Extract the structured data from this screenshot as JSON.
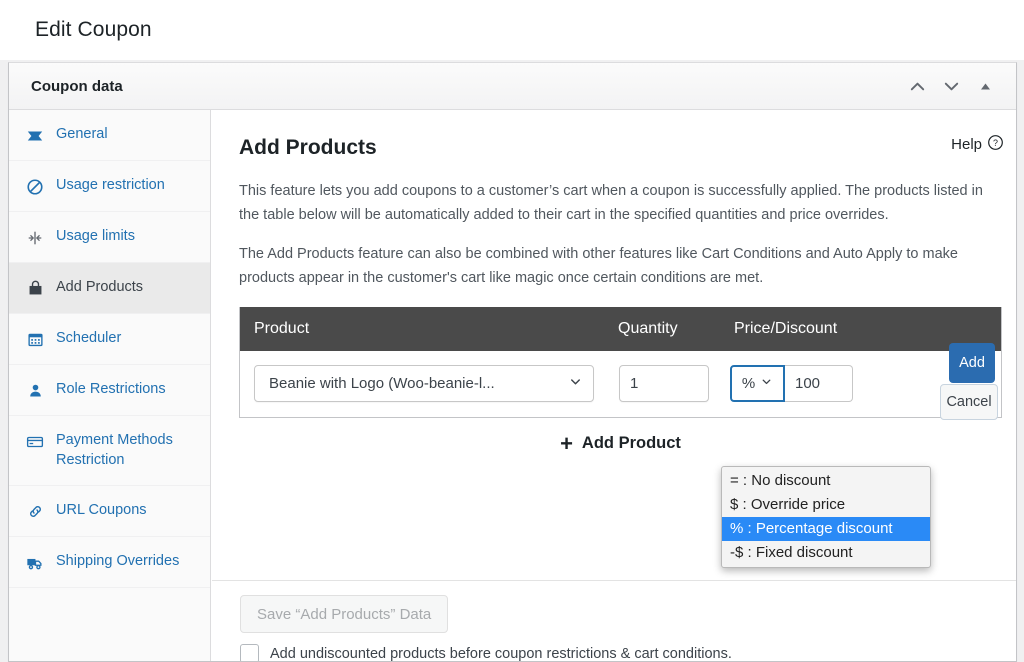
{
  "page": {
    "title": "Edit Coupon"
  },
  "panel": {
    "title": "Coupon data",
    "controls": [
      {
        "name": "move-up-icon",
        "label": "Move up"
      },
      {
        "name": "move-down-icon",
        "label": "Move down"
      },
      {
        "name": "toggle-panel-icon",
        "label": "Toggle panel"
      }
    ]
  },
  "sidebar": {
    "items": [
      {
        "label": "General",
        "icon": "ticket-icon",
        "active": false
      },
      {
        "label": "Usage restriction",
        "icon": "prohibited-icon",
        "active": false
      },
      {
        "label": "Usage limits",
        "icon": "limits-icon",
        "active": false
      },
      {
        "label": "Add Products",
        "icon": "shopping-bag-icon",
        "active": true
      },
      {
        "label": "Scheduler",
        "icon": "calendar-icon",
        "active": false
      },
      {
        "label": "Role Restrictions",
        "icon": "user-icon",
        "active": false
      },
      {
        "label": "Payment Methods Restriction",
        "icon": "credit-card-icon",
        "active": false
      },
      {
        "label": "URL Coupons",
        "icon": "link-icon",
        "active": false
      },
      {
        "label": "Shipping Overrides",
        "icon": "truck-icon",
        "active": false
      }
    ]
  },
  "main": {
    "help_label": "Help",
    "section_title": "Add Products",
    "paragraph_1": "This feature lets you add coupons to a customer’s cart when a coupon is successfully applied. The products listed in the table below will be automatically added to their cart in the specified quantities and price overrides.",
    "paragraph_2": "The Add Products feature can also be combined with other features like Cart Conditions and Auto Apply to make products appear in the customer's cart like magic once certain conditions are met.",
    "table": {
      "headers": {
        "product": "Product",
        "quantity": "Quantity",
        "price_discount": "Price/Discount"
      },
      "row": {
        "product_value": "Beanie with Logo (Woo-beanie-l...",
        "quantity_value": "1",
        "discount_type_value": "%",
        "discount_amount_value": "100",
        "add_label": "Add",
        "cancel_label": "Cancel"
      }
    },
    "add_product_label": "Add Product",
    "add_product_plus": "+"
  },
  "discount_dropdown": {
    "options": [
      {
        "label": "= : No discount",
        "selected": false
      },
      {
        "label": "$ : Override price",
        "selected": false
      },
      {
        "label": "% : Percentage discount",
        "selected": true
      },
      {
        "label": "-$ : Fixed discount",
        "selected": false
      }
    ]
  },
  "footer": {
    "save_label": "Save “Add Products” Data",
    "undiscounted_label": "Add undiscounted products before coupon restrictions & cart conditions.",
    "undiscounted_checked": false
  },
  "colors": {
    "accent_blue": "#2271b1",
    "button_blue": "#2b6cb0",
    "table_header": "#4a4a4a",
    "highlight": "#2a8af6"
  }
}
